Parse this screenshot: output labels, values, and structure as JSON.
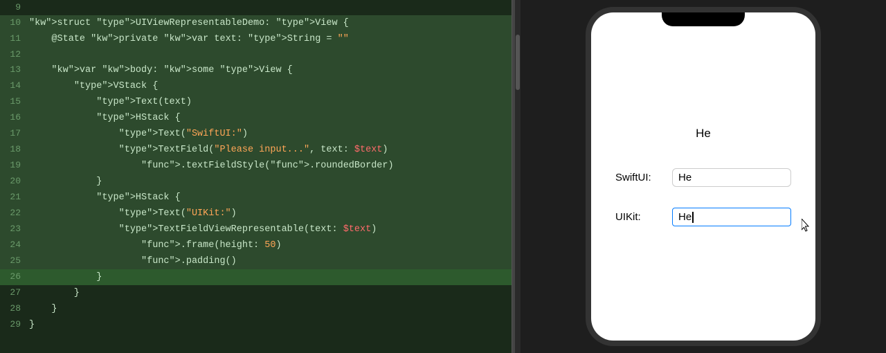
{
  "editor": {
    "lines": [
      {
        "num": 9,
        "content": "",
        "highlighted": false,
        "current": false
      },
      {
        "num": 10,
        "content": "struct UIViewRepresentableDemo: View {",
        "highlighted": true,
        "current": false
      },
      {
        "num": 11,
        "content": "    @State private var text: String = \"\"",
        "highlighted": true,
        "current": false
      },
      {
        "num": 12,
        "content": "",
        "highlighted": true,
        "current": false
      },
      {
        "num": 13,
        "content": "    var body: some View {",
        "highlighted": true,
        "current": false
      },
      {
        "num": 14,
        "content": "        VStack {",
        "highlighted": true,
        "current": false
      },
      {
        "num": 15,
        "content": "            Text(text)",
        "highlighted": true,
        "current": false
      },
      {
        "num": 16,
        "content": "            HStack {",
        "highlighted": true,
        "current": false
      },
      {
        "num": 17,
        "content": "                Text(\"SwiftUI:\")",
        "highlighted": true,
        "current": false
      },
      {
        "num": 18,
        "content": "                TextField(\"Please input...\", text: $text)",
        "highlighted": true,
        "current": false
      },
      {
        "num": 19,
        "content": "                    .textFieldStyle(.roundedBorder)",
        "highlighted": true,
        "current": false
      },
      {
        "num": 20,
        "content": "            }",
        "highlighted": true,
        "current": false
      },
      {
        "num": 21,
        "content": "            HStack {",
        "highlighted": true,
        "current": false
      },
      {
        "num": 22,
        "content": "                Text(\"UIKit:\")",
        "highlighted": true,
        "current": false
      },
      {
        "num": 23,
        "content": "                TextFieldViewRepresentable(text: $text)",
        "highlighted": true,
        "current": false
      },
      {
        "num": 24,
        "content": "                    .frame(height: 50)",
        "highlighted": true,
        "current": false
      },
      {
        "num": 25,
        "content": "                    .padding()",
        "highlighted": true,
        "current": false
      },
      {
        "num": 26,
        "content": "            }",
        "highlighted": false,
        "current": true
      },
      {
        "num": 27,
        "content": "        }",
        "highlighted": false,
        "current": false
      },
      {
        "num": 28,
        "content": "    }",
        "highlighted": false,
        "current": false
      },
      {
        "num": 29,
        "content": "}",
        "highlighted": false,
        "current": false
      }
    ]
  },
  "preview": {
    "top_text": "He",
    "swiftui_label": "SwiftUI:",
    "swiftui_value": "He",
    "uikit_label": "UIKit:",
    "uikit_value": "He"
  }
}
